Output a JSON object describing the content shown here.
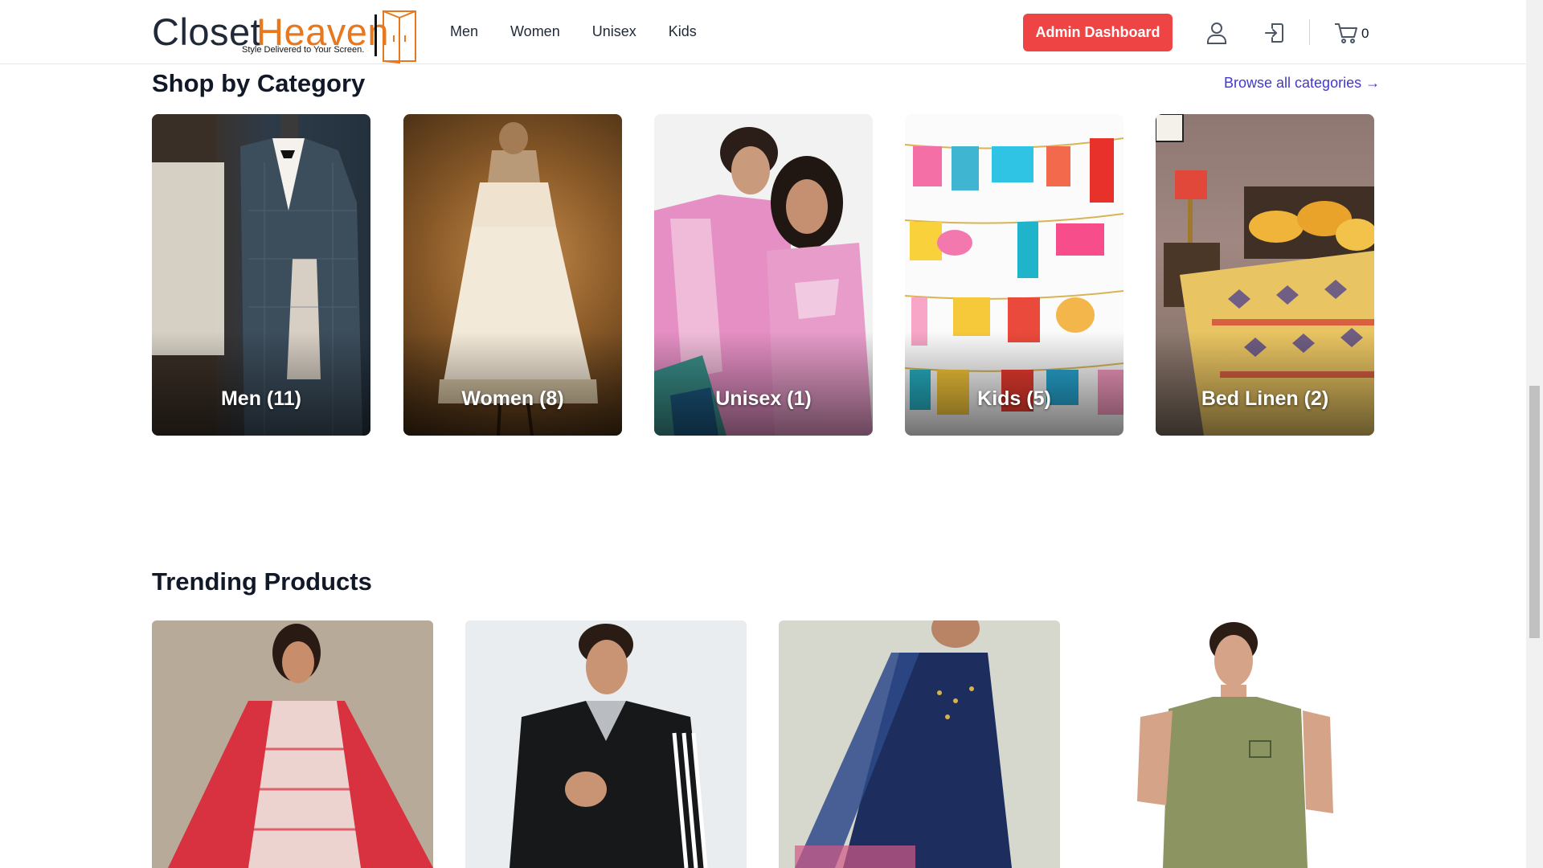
{
  "brand": {
    "name_part1": "Closet",
    "name_part2": "Heaven",
    "tagline": "Style Delivered to Your Screen.",
    "accent_color": "#e8781e"
  },
  "nav": {
    "items": [
      "Men",
      "Women",
      "Unisex",
      "Kids"
    ]
  },
  "header": {
    "admin_button": "Admin Dashboard",
    "admin_button_color": "#ef4444",
    "cart_count": "0",
    "icons": [
      "user-icon",
      "logout-icon",
      "cart-icon"
    ]
  },
  "categories": {
    "title": "Shop by Category",
    "browse_link": "Browse all categories →",
    "link_color": "#4338ca",
    "items": [
      {
        "label": "Men (11)"
      },
      {
        "label": "Women (8)"
      },
      {
        "label": "Unisex (1)"
      },
      {
        "label": "Kids (5)"
      },
      {
        "label": "Bed Linen (2)"
      }
    ]
  },
  "trending": {
    "title": "Trending Products",
    "products": [
      {
        "image": "women-red-anarkali-suit"
      },
      {
        "image": "men-black-track-jacket"
      },
      {
        "image": "women-navy-kurta-dupatta"
      },
      {
        "image": "men-olive-tshirt"
      }
    ]
  }
}
